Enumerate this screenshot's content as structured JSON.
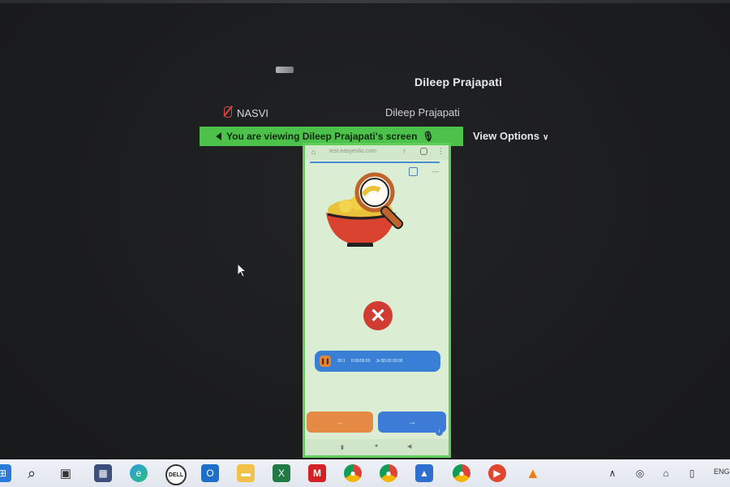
{
  "meeting": {
    "host_name": "Dileep Prajapati",
    "participant_left": "NASVI",
    "participant_right": "Dileep Prajapati",
    "banner_text": "You are viewing  Dileep Prajapati's screen",
    "view_options_label": "View Options"
  },
  "shared_screen": {
    "url_text": "test.easyestio.com",
    "audio_bar": {
      "segments": [
        "00:1",
        "0:00/00:00",
        "Jo   $0:00 00:00"
      ]
    },
    "prev_label": "←",
    "next_label": "→",
    "close_glyph": "✕"
  },
  "taskbar": {
    "language": "ENG",
    "icons": [
      "start-icon",
      "search-icon",
      "task-view-icon",
      "calculator-icon",
      "edge-icon",
      "dell-icon",
      "outlook-icon",
      "file-explorer-icon",
      "excel-icon",
      "mcafee-icon",
      "chrome-icon",
      "chrome-profile-icon",
      "photos-icon",
      "chrome-icon-2",
      "media-player-icon",
      "vlc-icon"
    ]
  },
  "colors": {
    "banner": "#4cc24a",
    "close": "#d23b32",
    "audio_bar": "#3a7fd6",
    "prev_button": "#e58a45",
    "next_button": "#3e7bd6"
  }
}
